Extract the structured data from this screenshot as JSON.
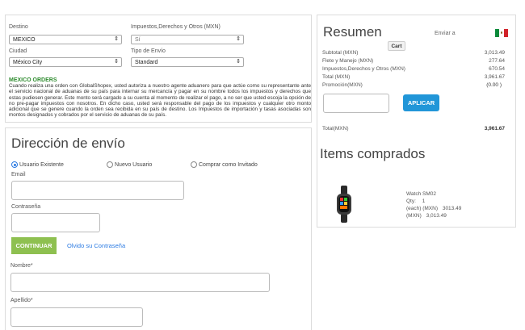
{
  "customs": {
    "destino_label": "Destino",
    "destino_value": "MEXICO",
    "impuestos_label": "Impuestos,Derechos y Otros (MXN)",
    "impuestos_value": "Sí",
    "ciudad_label": "Ciudad",
    "ciudad_value": "México City",
    "tipo_envio_label": "Tipo de Envío",
    "tipo_envio_value": "Standard",
    "notice_title": "MEXICO ORDERS",
    "notice_text": "Cuando realiza una orden con GlobalShopex, usted autoriza a nuestro agente aduanero para que actúe como su representante ante el servicio nacional de aduanas de su país para internar su mercancía y pagar en su nombre todos los impuestos y derechos que estas pudiesen generar. Este monto será cargado a su cuenta al momento de realizar el pago, a no ser que usted escoja la opción de no pre-pagar impuestos con nosotros. En dicho caso, usted será responsable del pago de los impuestos y cualquier otro monto adicional que se genere cuando la orden sea recibida en su país de destino. Los Impuestos de importación y tasas asociadas son montos designados y cobrados por el servicio de aduanas de su país."
  },
  "shipping": {
    "title": "Dirección de envío",
    "radio_existing": "Usuario Existente",
    "radio_new": "Nuevo Usuario",
    "radio_guest": "Comprar como Invitado",
    "email_label": "Email",
    "password_label": "Contraseña",
    "continue_label": "CONTINUAR",
    "forgot_label": "Olvido su Contraseña",
    "nombre_label": "Nombre*",
    "apellido_label": "Apellido*"
  },
  "summary": {
    "title": "Resumen",
    "ship_to_label": "Enviar a",
    "cart_label": "Cart",
    "rows": [
      {
        "label": "Subtotal (MXN)",
        "value": "3,013.49"
      },
      {
        "label": "Flete y Manejo (MXN)",
        "value": "277.64"
      },
      {
        "label": "Impuestos,Derechos y Otros (MXN)",
        "value": "670.54"
      },
      {
        "label": "Total (MXN)",
        "value": "3,961.67"
      },
      {
        "label": "Promoción(MXN)",
        "value": "(0.00  )"
      }
    ],
    "apply_label": "APLICAR",
    "total_label": "Total(MXN)",
    "total_value": "3,961.67"
  },
  "items": {
    "title": "Items comprados",
    "list": [
      {
        "name": "Watch SM02",
        "qty_label": "Qty:",
        "qty": "1",
        "each_label": "(each) (MXN)",
        "each": "3013.49",
        "sub_label": "(MXN)",
        "sub": "3,013.49"
      }
    ]
  },
  "colors": {
    "accent_green": "#8ec050",
    "accent_blue": "#2196d8",
    "customs_green": "#2e8b2e"
  }
}
